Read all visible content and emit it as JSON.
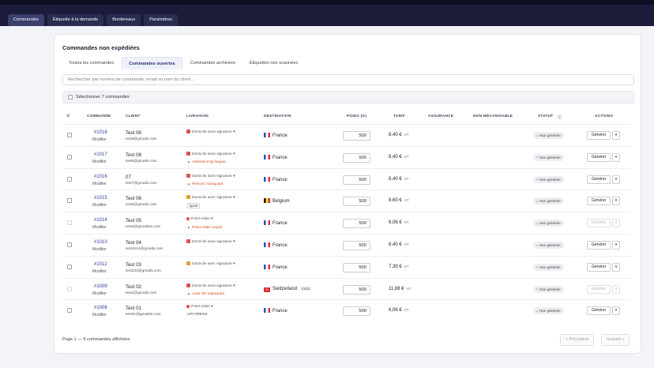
{
  "nav": [
    {
      "label": "Commandes",
      "active": true
    },
    {
      "label": "Étiquette à la demande",
      "active": false
    },
    {
      "label": "Bordereaux",
      "active": false
    },
    {
      "label": "Paramètres",
      "active": false
    }
  ],
  "card": {
    "title": "Commandes non expédiées",
    "tabs": [
      {
        "label": "Toutes les commandes",
        "active": false
      },
      {
        "label": "Commandes ouvertes",
        "active": true
      },
      {
        "label": "Commandes archivées",
        "active": false
      },
      {
        "label": "Étiquettes non scannées",
        "active": false
      }
    ],
    "search_placeholder": "Rechercher par numéro de commande, email ou nom du client...",
    "select_all_label": "Sélectionner 7 commandes"
  },
  "columns": {
    "settings": "⚙",
    "commande": "COMMANDE",
    "client": "CLIENT",
    "livraison": "LIVRAISON",
    "destination": "DESTINATION",
    "poids": "POIDS (G)",
    "tarif": "TARIF",
    "assurance": "ASSURANCE",
    "non_mecanisable": "NON MÉCANISABLE",
    "statut": "STATUT",
    "statut_info": "ⓘ",
    "actions": "ACTIONS"
  },
  "rows": [
    {
      "id": "#1018",
      "modify": "Modifier",
      "name": "Test 09",
      "email": "test9@gmails.com",
      "service": "Domicile sans signature",
      "service_icon": "package-red",
      "note": "",
      "sub": "",
      "chip": "",
      "destination": "France",
      "flag": "fr",
      "weight": "500",
      "price": "8,40 €",
      "ht": "HT",
      "status": "Non générée",
      "action": "Générer",
      "disabled": false,
      "has_cz": false
    },
    {
      "id": "#1017",
      "modify": "Modifier",
      "name": "Test 08",
      "email": "test8@gmails.com",
      "service": "Domicile sans signature",
      "service_icon": "package-red",
      "note": "Adresse trop longue",
      "sub": "",
      "chip": "",
      "destination": "France",
      "flag": "fr",
      "weight": "500",
      "price": "8,40 €",
      "ht": "HT",
      "status": "Non générée",
      "action": "Générer",
      "disabled": false,
      "has_cz": false
    },
    {
      "id": "#1016",
      "modify": "Modifier",
      "name": "07",
      "email": "test7@gmails.com",
      "service": "Domicile sans signature",
      "service_icon": "package-red",
      "note": "Prénom manquant",
      "sub": "",
      "chip": "",
      "destination": "France",
      "flag": "fr",
      "weight": "500",
      "price": "8,40 €",
      "ht": "HT",
      "status": "Non générée",
      "action": "Générer",
      "disabled": false,
      "has_cz": false
    },
    {
      "id": "#1015",
      "modify": "Modifier",
      "name": "Test 06",
      "email": "test6@gmails.com",
      "service": "Domicile avec signature",
      "service_icon": "package-amber",
      "note": "",
      "sub": "",
      "chip": "bpost",
      "destination": "Belgium",
      "flag": "be",
      "weight": "500",
      "price": "8,60 €",
      "ht": "HT",
      "status": "Non générée",
      "action": "Générer",
      "disabled": false,
      "has_cz": false
    },
    {
      "id": "#1014",
      "modify": "Modifier",
      "name": "Test 05",
      "email": "test5@gmailsss.com",
      "service": "Point relais",
      "service_icon": "pin",
      "note": "Point relais requis",
      "sub": "",
      "chip": "",
      "destination": "France",
      "flag": "fr",
      "weight": "500",
      "price": "6,06 €",
      "ht": "HT",
      "status": "Non générée",
      "action": "Générer",
      "disabled": true,
      "has_cz": false
    },
    {
      "id": "#1013",
      "modify": "Modifier",
      "name": "Test 04",
      "email": "test4444@gmails.com",
      "service": "Domicile sans signature",
      "service_icon": "package-red",
      "note": "",
      "sub": "",
      "chip": "",
      "destination": "France",
      "flag": "fr",
      "weight": "500",
      "price": "8,40 €",
      "ht": "HT",
      "status": "Non générée",
      "action": "Générer",
      "disabled": false,
      "has_cz": false
    },
    {
      "id": "#1012",
      "modify": "Modifier",
      "name": "Test 03",
      "email": "test333@gmails.com",
      "service": "Domicile avec signature",
      "service_icon": "package-amber",
      "note": "",
      "sub": "",
      "chip": "",
      "destination": "France",
      "flag": "fr",
      "weight": "500",
      "price": "7,39 €",
      "ht": "HT",
      "status": "Non générée",
      "action": "Générer",
      "disabled": false,
      "has_cz": false
    },
    {
      "id": "#1009",
      "modify": "Modifier",
      "name": "Test 02",
      "email": "test2@gmails.com",
      "service": "Domicile sans signature",
      "service_icon": "package-red",
      "note": "code SH manquant",
      "sub": "",
      "chip": "",
      "destination": "Switzerland",
      "flag": "ch",
      "weight": "500",
      "price": "11,88 €",
      "ht": "HT",
      "status": "Non générée",
      "action": "Générer",
      "disabled": true,
      "has_cz": true,
      "cz_label": "CN23"
    },
    {
      "id": "#1008",
      "modify": "Modifier",
      "name": "Test 01",
      "email": "test01@gmailss.com",
      "service": "Point relais",
      "service_icon": "pin",
      "note": "",
      "sub": "UPI PRESS",
      "chip": "",
      "destination": "France",
      "flag": "fr",
      "weight": "500",
      "price": "6,06 €",
      "ht": "HT",
      "status": "Non générée",
      "action": "Générer",
      "disabled": false,
      "has_cz": false
    }
  ],
  "footer": {
    "summary": "Page 1 — 9 commandes affichées",
    "prev": "« Précédent",
    "next": "Suivant »"
  },
  "colors": {
    "nav_bg": "#1a1c3a",
    "link": "#2f3a9a",
    "warning": "#d44a1f"
  }
}
